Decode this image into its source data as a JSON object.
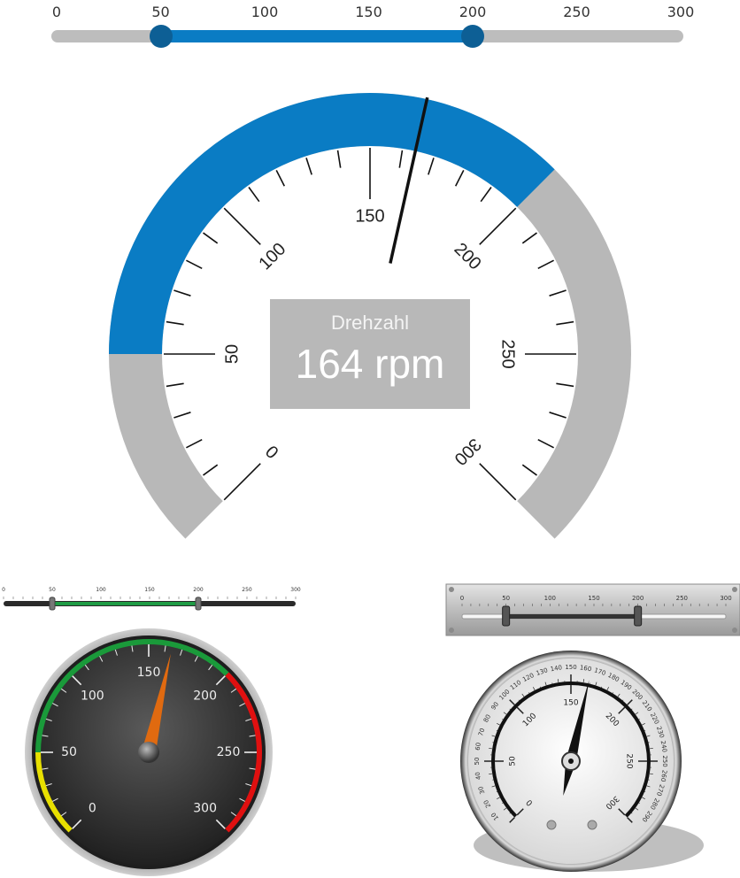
{
  "top_slider": {
    "ticks": [
      "0",
      "50",
      "100",
      "150",
      "200",
      "250",
      "300"
    ],
    "min": 0,
    "max": 300,
    "low_value": 50,
    "high_value": 200,
    "track_color": "#bdbdbd",
    "fill_color": "#0a7cc4",
    "thumb_color": "#0d5f95"
  },
  "main_gauge": {
    "title": "Drehzahl",
    "value_text": "164 rpm",
    "value": 164,
    "min": 0,
    "max": 300,
    "range_low": 50,
    "range_high": 200,
    "major_labels": [
      "0",
      "50",
      "100",
      "150",
      "200",
      "250",
      "300"
    ],
    "band_color": "#0a7cc4",
    "track_color": "#b8b8b8",
    "needle_color": "#111111"
  },
  "dark_slider": {
    "ticks": [
      "0",
      "50",
      "100",
      "150",
      "200",
      "250",
      "300"
    ],
    "low_value": 50,
    "high_value": 200,
    "fill_color": "#1f9c45"
  },
  "dark_gauge": {
    "labels": [
      "0",
      "50",
      "100",
      "150",
      "200",
      "250",
      "300"
    ],
    "value": 164,
    "zones": {
      "yellow": "#e8e000",
      "green": "#1a9a3a",
      "red": "#e01010"
    },
    "needle_color": "#e06a10"
  },
  "metal_slider": {
    "ticks": [
      "0",
      "50",
      "100",
      "150",
      "200",
      "250",
      "300"
    ],
    "low_value": 50,
    "high_value": 200
  },
  "classic_gauge": {
    "inner_labels": [
      "0",
      "50",
      "100",
      "150",
      "200",
      "250",
      "300"
    ],
    "outer_labels": [
      "10",
      "20",
      "30",
      "40",
      "50",
      "60",
      "70",
      "80",
      "90",
      "100",
      "110",
      "120",
      "130",
      "140",
      "150",
      "160",
      "170",
      "180",
      "190",
      "200",
      "210",
      "220",
      "230",
      "240",
      "250",
      "260",
      "270",
      "280",
      "290"
    ],
    "value": 164
  }
}
